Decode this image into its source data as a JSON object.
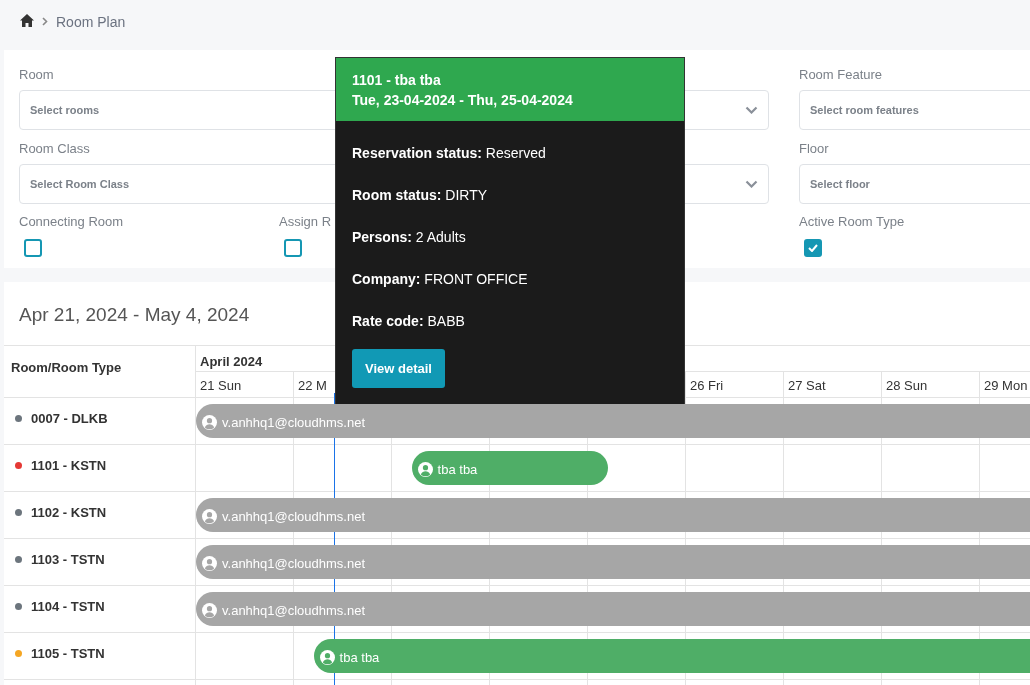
{
  "breadcrumb": {
    "current": "Room Plan"
  },
  "filters": {
    "fields": [
      {
        "label": "Room",
        "placeholder": "Select rooms",
        "kind": "wide"
      },
      {
        "kind": "select"
      },
      {
        "label": "Room Feature",
        "placeholder": "Select room features",
        "kind": "plain"
      },
      {
        "label": "Room Class",
        "placeholder": "Select Room Class",
        "kind": "wide"
      },
      {
        "kind": "select"
      },
      {
        "label": "Floor",
        "placeholder": "Select floor",
        "kind": "plain"
      }
    ],
    "checkboxes": [
      {
        "label": "Connecting Room",
        "checked": false
      },
      {
        "label": "Assign R",
        "checked": false
      },
      {
        "label": "Active Room Type",
        "checked": true
      }
    ]
  },
  "timeline": {
    "range": "Apr 21, 2024 - May 4, 2024",
    "room_column": "Room/Room Type",
    "month": "April 2024",
    "days": [
      {
        "label": "21 Sun"
      },
      {
        "label": "22 M"
      },
      {
        "label": "26 Fri"
      },
      {
        "label": "27 Sat"
      },
      {
        "label": "28 Sun"
      },
      {
        "label": "29 Mon"
      }
    ],
    "rooms": [
      {
        "name": "0007 - DLKB",
        "color": "#6c757d",
        "bookings": [
          {
            "guest": "v.anhhq1@cloudhms.net",
            "kind": "ongoing",
            "color": "#a6a6a6"
          }
        ]
      },
      {
        "name": "1101 - KSTN",
        "color": "#e53935",
        "bookings": [
          {
            "guest": "tba tba",
            "kind": "short",
            "color": "#4fae67"
          }
        ]
      },
      {
        "name": "1102 - KSTN",
        "color": "#6c757d",
        "bookings": [
          {
            "guest": "v.anhhq1@cloudhms.net",
            "kind": "ongoing",
            "color": "#a6a6a6"
          }
        ]
      },
      {
        "name": "1103 - TSTN",
        "color": "#6c757d",
        "bookings": [
          {
            "guest": "v.anhhq1@cloudhms.net",
            "kind": "ongoing",
            "color": "#a6a6a6"
          }
        ]
      },
      {
        "name": "1104 - TSTN",
        "color": "#6c757d",
        "bookings": [
          {
            "guest": "v.anhhq1@cloudhms.net",
            "kind": "ongoing",
            "color": "#a6a6a6"
          }
        ]
      },
      {
        "name": "1105 - TSTN",
        "color": "#f5a623",
        "bookings": [
          {
            "guest": "tba tba",
            "kind": "long",
            "color": "#4fae67"
          }
        ]
      }
    ]
  },
  "tooltip": {
    "title": "1101 - tba tba",
    "dates": "Tue, 23-04-2024 - Thu, 25-04-2024",
    "lines": [
      "**Reservation status:** Reserved",
      "**Room status:** DIRTY",
      "**Persons:** 2 Adults",
      "**Company:** FRONT OFFICE",
      "**Rate code:** BABB"
    ],
    "button": "View detail"
  }
}
